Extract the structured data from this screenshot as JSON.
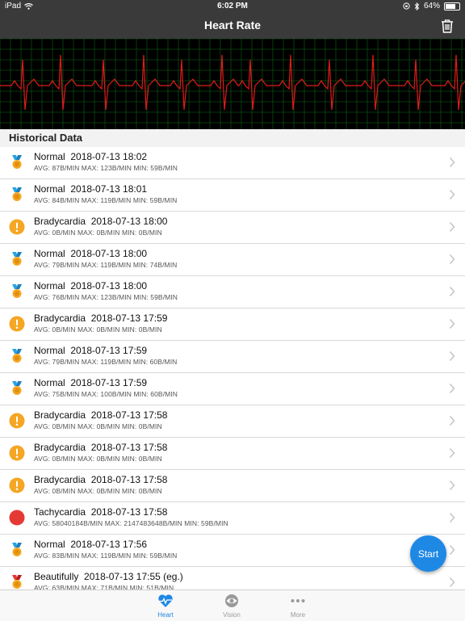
{
  "status_bar": {
    "device": "iPad",
    "time": "6:02 PM",
    "battery": "64%"
  },
  "nav": {
    "title": "Heart Rate",
    "trash_icon": "trash-icon"
  },
  "section": {
    "header": "Historical Data"
  },
  "records": [
    {
      "status": "Normal",
      "date": "2018-07-13 18:02",
      "detail": "AVG: 87B/MIN  MAX: 123B/MIN  MIN: 59B/MIN",
      "icon": "medal-icon"
    },
    {
      "status": "Normal",
      "date": "2018-07-13 18:01",
      "detail": "AVG: 84B/MIN  MAX: 119B/MIN  MIN: 59B/MIN",
      "icon": "medal-icon"
    },
    {
      "status": "Bradycardia",
      "date": "2018-07-13 18:00",
      "detail": "AVG: 0B/MIN  MAX: 0B/MIN  MIN: 0B/MIN",
      "icon": "warning-icon"
    },
    {
      "status": "Normal",
      "date": "2018-07-13 18:00",
      "detail": "AVG: 79B/MIN  MAX: 119B/MIN  MIN: 74B/MIN",
      "icon": "medal-icon"
    },
    {
      "status": "Normal",
      "date": "2018-07-13 18:00",
      "detail": "AVG: 76B/MIN  MAX: 123B/MIN  MIN: 59B/MIN",
      "icon": "medal-icon"
    },
    {
      "status": "Bradycardia",
      "date": "2018-07-13 17:59",
      "detail": "AVG: 0B/MIN  MAX: 0B/MIN  MIN: 0B/MIN",
      "icon": "warning-icon"
    },
    {
      "status": "Normal",
      "date": "2018-07-13 17:59",
      "detail": "AVG: 79B/MIN  MAX: 119B/MIN  MIN: 60B/MIN",
      "icon": "medal-icon"
    },
    {
      "status": "Normal",
      "date": "2018-07-13 17:59",
      "detail": "AVG: 75B/MIN  MAX: 100B/MIN  MIN: 60B/MIN",
      "icon": "medal-icon"
    },
    {
      "status": "Bradycardia",
      "date": "2018-07-13 17:58",
      "detail": "AVG: 0B/MIN  MAX: 0B/MIN  MIN: 0B/MIN",
      "icon": "warning-icon"
    },
    {
      "status": "Bradycardia",
      "date": "2018-07-13 17:58",
      "detail": "AVG: 0B/MIN  MAX: 0B/MIN  MIN: 0B/MIN",
      "icon": "warning-icon"
    },
    {
      "status": "Bradycardia",
      "date": "2018-07-13 17:58",
      "detail": "AVG: 0B/MIN  MAX: 0B/MIN  MIN: 0B/MIN",
      "icon": "warning-icon"
    },
    {
      "status": "Tachycardia",
      "date": "2018-07-13 17:58",
      "detail": "AVG: 58040184B/MIN  MAX: 2147483648B/MIN  MIN: 59B/MIN",
      "icon": "alert-dot-icon"
    },
    {
      "status": "Normal",
      "date": "2018-07-13 17:56",
      "detail": "AVG: 83B/MIN  MAX: 119B/MIN  MIN: 59B/MIN",
      "icon": "medal-icon"
    },
    {
      "status": "Beautifully",
      "date": "2018-07-13 17:55 (eg.)",
      "detail": "AVG: 63B/MIN  MAX: 71B/MIN  MIN: 51B/MIN",
      "icon": "red-medal-icon"
    }
  ],
  "fab": {
    "label": "Start"
  },
  "tabs": [
    {
      "label": "Heart",
      "icon": "heart-pulse-icon",
      "color": "#1e88e5"
    },
    {
      "label": "Vision",
      "icon": "eye-icon",
      "color": "#9a9a9a"
    },
    {
      "label": "More",
      "icon": "more-dots-icon",
      "color": "#9a9a9a"
    }
  ],
  "colors": {
    "bar_bg": "#3a3a3a",
    "ecg_bg": "#000000",
    "ecg_grid": "#0b4d12",
    "ecg_line": "#e01b1b",
    "accent": "#1e88e5",
    "warning": "#f5a623",
    "alert": "#e53935"
  }
}
